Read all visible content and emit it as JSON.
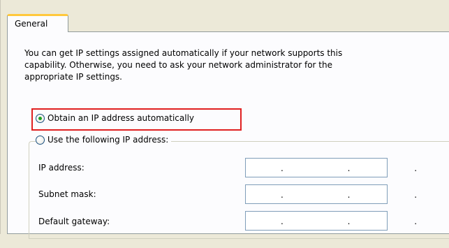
{
  "tabs": [
    {
      "label": "General"
    }
  ],
  "intro": {
    "text": "You can get IP settings assigned automatically if your network supports this\ncapability. Otherwise, you need to ask your network administrator for the\nappropriate IP settings."
  },
  "options": {
    "auto_ip": {
      "label": "Obtain an IP address automatically",
      "selected": true
    },
    "manual_ip": {
      "label": "Use the following IP address:",
      "selected": false
    }
  },
  "fields": {
    "ip_address": {
      "label": "IP address:",
      "value": ". . ."
    },
    "subnet_mask": {
      "label": "Subnet mask:",
      "value": ". . ."
    },
    "default_gateway": {
      "label": "Default gateway:",
      "value": ". . ."
    }
  },
  "colors": {
    "highlight": "#e02020",
    "tab_accent": "#ffc83c",
    "radio_dot": "#21a121",
    "dialog_bg": "#ece9d8",
    "panel_bg": "#fcfcfe"
  }
}
